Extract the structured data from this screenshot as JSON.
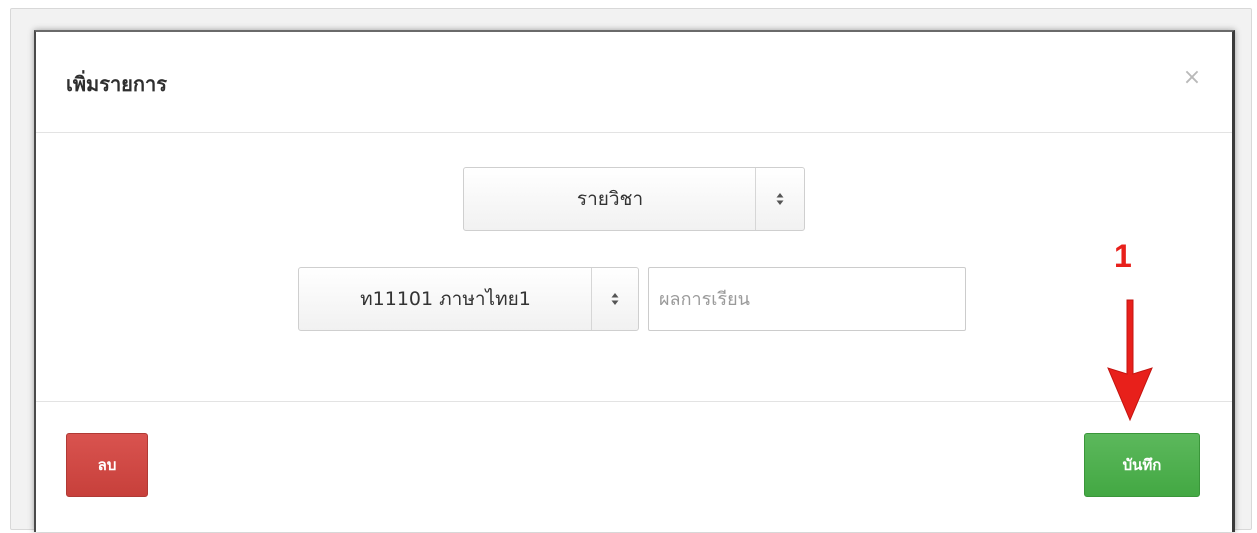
{
  "modal": {
    "title": "เพิ่มรายการ",
    "close_label": "×"
  },
  "form": {
    "subject_type_select": {
      "selected": "รายวิชา",
      "arrow_icon": "select-updown-icon"
    },
    "course_select": {
      "selected": "ท11101 ภาษาไทย1",
      "arrow_icon": "select-updown-icon"
    },
    "result_input": {
      "value": "",
      "placeholder": "ผลการเรียน"
    }
  },
  "footer": {
    "delete_label": "ลบ",
    "save_label": "บันทึก"
  },
  "annotation": {
    "step_number": "1",
    "color": "#e8201b"
  },
  "colors": {
    "danger": "#d9534f",
    "success": "#5cb85c"
  }
}
